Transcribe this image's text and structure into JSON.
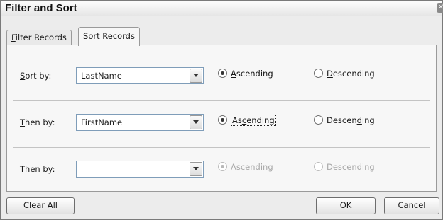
{
  "window": {
    "title": "Filter and Sort"
  },
  "tabs": [
    {
      "label": "Filter Records",
      "accel": "F",
      "rest": "ilter Records",
      "active": false
    },
    {
      "label": "Sort Records",
      "pre": "S",
      "accel": "o",
      "rest": "rt Records",
      "active": true
    }
  ],
  "sort_rows": [
    {
      "label_pre": "",
      "label_accel": "S",
      "label_rest": "ort by:",
      "field_value": "LastName",
      "asc": {
        "pre": "",
        "accel": "A",
        "rest": "scending",
        "selected": true
      },
      "desc": {
        "pre": "",
        "accel": "D",
        "rest": "escending",
        "selected": false
      },
      "enabled": true
    },
    {
      "label_pre": "",
      "label_accel": "T",
      "label_rest": "hen by:",
      "field_value": "FirstName",
      "asc": {
        "pre": "As",
        "accel": "c",
        "rest": "ending",
        "selected": true
      },
      "desc": {
        "pre": "Descending",
        "accel": "",
        "rest": "",
        "selected": false
      },
      "enabled": true
    },
    {
      "label_pre": "Then ",
      "label_accel": "b",
      "label_rest": "y:",
      "field_value": "",
      "asc": {
        "pre": "Ascending",
        "accel": "",
        "rest": "",
        "selected": true
      },
      "desc": {
        "pre": "Descending",
        "accel": "",
        "rest": "",
        "selected": false
      },
      "enabled": false
    }
  ],
  "buttons": {
    "clear": {
      "label": "Clear All",
      "accel": "C",
      "rest": "lear All"
    },
    "ok": {
      "label": "OK"
    },
    "cancel": {
      "label": "Cancel"
    }
  },
  "second_desc_label": {
    "pre": "Descen",
    "accel": "d",
    "rest": "ing"
  }
}
